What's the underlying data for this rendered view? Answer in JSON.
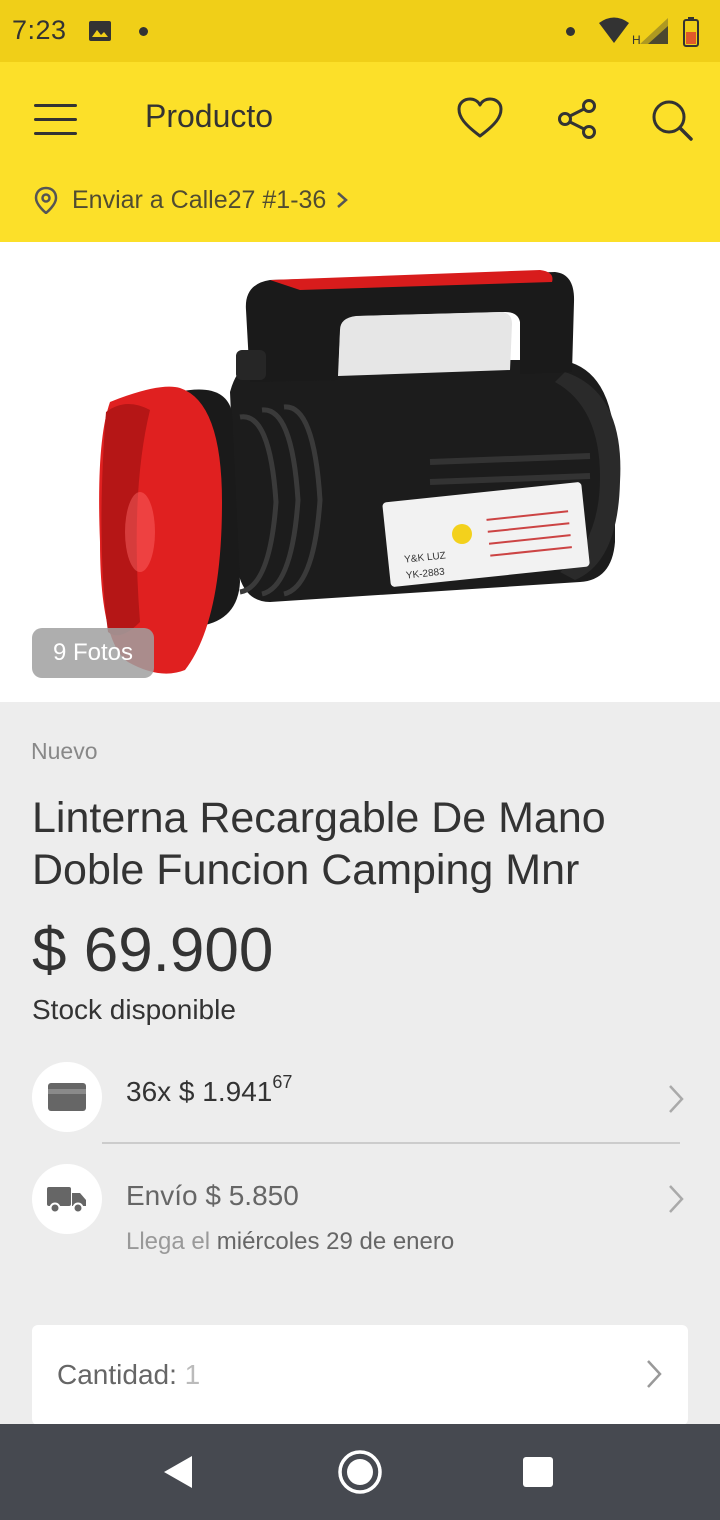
{
  "status_bar": {
    "time": "7:23"
  },
  "app_bar": {
    "title": "Producto",
    "address": "Enviar a Calle27 #1-36"
  },
  "gallery": {
    "photos_count_label": "9 Fotos",
    "product_label_brand": "Y&K LUZ",
    "product_label_model": "YK-2883"
  },
  "product": {
    "condition": "Nuevo",
    "title": "Linterna Recargable De Mano Doble Funcion Camping Mnr",
    "price": "$ 69.900",
    "stock": "Stock disponible"
  },
  "installments": {
    "text": "36x $ 1.941",
    "cents": "67"
  },
  "shipping": {
    "text": "Envío $ 5.850",
    "arrival_prefix": "Llega el",
    "arrival_date": "miércoles 29 de enero"
  },
  "quantity": {
    "label": "Cantidad:",
    "value": "1"
  },
  "colors": {
    "status_bar": "#f0cf18",
    "app_bar": "#fce029",
    "background": "#ededed",
    "nav_bar": "#464950"
  }
}
